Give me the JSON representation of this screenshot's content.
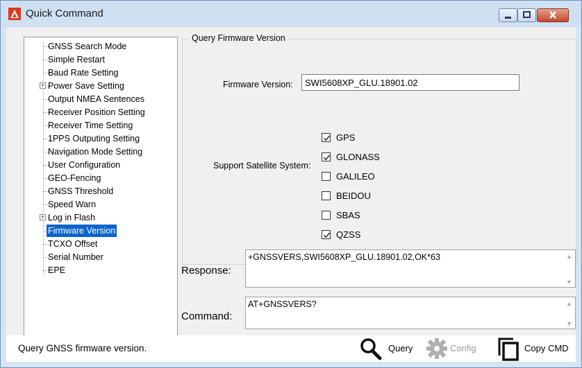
{
  "window": {
    "title": "Quick Command"
  },
  "tree": {
    "items": [
      {
        "label": "GNSS Search Mode",
        "expandable": false
      },
      {
        "label": "Simple Restart",
        "expandable": false
      },
      {
        "label": "Baud Rate Setting",
        "expandable": false
      },
      {
        "label": "Power Save Setting",
        "expandable": true
      },
      {
        "label": "Output NMEA Sentences",
        "expandable": false
      },
      {
        "label": "Receiver Position Setting",
        "expandable": false
      },
      {
        "label": "Receiver Time Setting",
        "expandable": false
      },
      {
        "label": "1PPS Outputing Setting",
        "expandable": false
      },
      {
        "label": "Navigation Mode Setting",
        "expandable": false
      },
      {
        "label": "User Configuration",
        "expandable": false
      },
      {
        "label": "GEO-Fencing",
        "expandable": false
      },
      {
        "label": "GNSS Threshold",
        "expandable": false
      },
      {
        "label": "Speed Warn",
        "expandable": false
      },
      {
        "label": "Log in Flash",
        "expandable": true
      },
      {
        "label": "Firmware Version",
        "expandable": false,
        "selected": true
      },
      {
        "label": "TCXO Offset",
        "expandable": false
      },
      {
        "label": "Serial Number",
        "expandable": false
      },
      {
        "label": "EPE",
        "expandable": false
      }
    ]
  },
  "panel": {
    "group_title": "Query Firmware Version",
    "firmware_label": "Firmware Version:",
    "firmware_value": "SWI5608XP_GLU.18901.02",
    "satellite_label": "Support Satellite System:",
    "satellites": [
      {
        "label": "GPS",
        "checked": true
      },
      {
        "label": "GLONASS",
        "checked": true
      },
      {
        "label": "GALILEO",
        "checked": false
      },
      {
        "label": "BEIDOU",
        "checked": false
      },
      {
        "label": "SBAS",
        "checked": false
      },
      {
        "label": "QZSS",
        "checked": true
      }
    ]
  },
  "response": {
    "label": "Response:",
    "value": "+GNSSVERS,SWI5608XP_GLU.18901.02,OK*63"
  },
  "command": {
    "label": "Command:",
    "value": "AT+GNSSVERS?"
  },
  "statusbar": {
    "text": "Query GNSS firmware version.",
    "query_label": "Query",
    "config_label": "Config",
    "copy_label": "Copy CMD"
  },
  "colors": {
    "selection": "#0a64cc",
    "titlebar": "#cfe0f3",
    "close": "#c34a2c",
    "disabled": "#9a9a9a"
  }
}
